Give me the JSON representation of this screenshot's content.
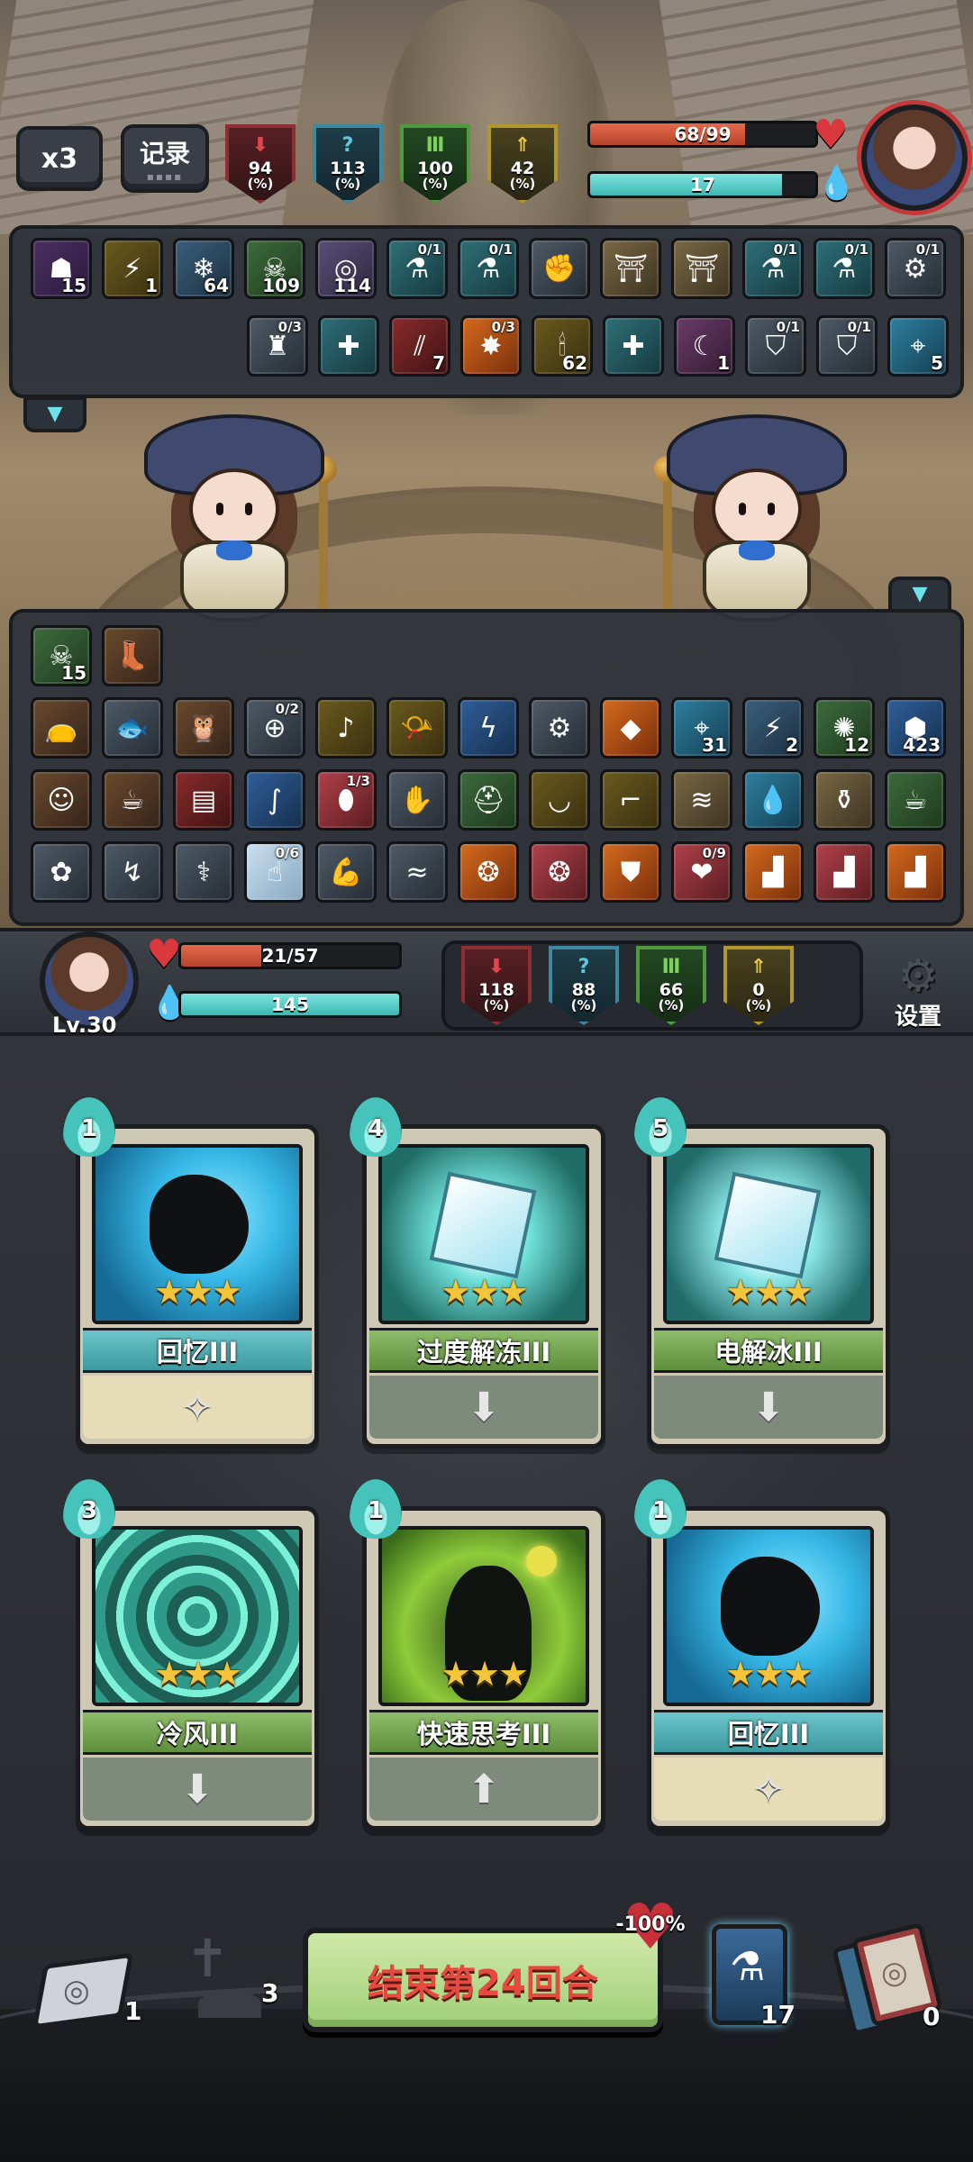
{
  "hud": {
    "speed_label": "x3",
    "log_label": "记录",
    "enemy_stats": [
      {
        "value": "94",
        "unit": "(%)",
        "color": "red",
        "icon": "attack-down-icon"
      },
      {
        "value": "113",
        "unit": "(%)",
        "color": "blue",
        "icon": "question-icon"
      },
      {
        "value": "100",
        "unit": "(%)",
        "color": "green",
        "icon": "defense-icon"
      },
      {
        "value": "42",
        "unit": "(%)",
        "color": "yellow",
        "icon": "speed-icon"
      }
    ],
    "enemy_hp_text": "68/99",
    "enemy_hp_fraction": 0.687,
    "enemy_mana_text": "17",
    "enemy_mana_fraction": 0.85
  },
  "enemy_status": {
    "row1": [
      {
        "icon": "curse-figure-icon",
        "count": "15",
        "color": "purple"
      },
      {
        "icon": "lightning-icon",
        "count": "1",
        "color": "gold"
      },
      {
        "icon": "snowflake-icon",
        "count": "64",
        "color": "ice"
      },
      {
        "icon": "poison-skull-icon",
        "count": "109",
        "color": "green"
      },
      {
        "icon": "spiral-icon",
        "count": "114",
        "color": "lilac"
      },
      {
        "icon": "potion-icon",
        "frac": "0/1",
        "color": "teal"
      },
      {
        "icon": "potion-icon",
        "frac": "0/1",
        "color": "teal"
      },
      {
        "icon": "fist-icon",
        "color": "slate"
      },
      {
        "icon": "pedestal-icon",
        "color": "sand"
      },
      {
        "icon": "pedestal-icon",
        "color": "sand"
      },
      {
        "icon": "potion-icon",
        "frac": "0/1",
        "color": "teal"
      },
      {
        "icon": "potion-icon",
        "frac": "0/1",
        "color": "teal"
      },
      {
        "icon": "robot-icon",
        "frac": "0/1",
        "color": "slate"
      }
    ],
    "row2": [
      {
        "icon": "statue-icon",
        "frac": "0/3",
        "color": "slate"
      },
      {
        "icon": "body-plus-icon",
        "color": "teal"
      },
      {
        "icon": "claw-icon",
        "count": "7",
        "color": "red"
      },
      {
        "icon": "burst-icon",
        "frac": "0/3",
        "color": "orange"
      },
      {
        "icon": "candle-icon",
        "count": "62",
        "color": "gold"
      },
      {
        "icon": "body-plus-icon",
        "color": "teal"
      },
      {
        "icon": "moon-icon",
        "count": "1",
        "color": "dpurple"
      },
      {
        "icon": "shield-icon",
        "frac": "0/1",
        "color": "slate"
      },
      {
        "icon": "shield-icon",
        "frac": "0/1",
        "color": "slate"
      },
      {
        "icon": "target-icon",
        "count": "5",
        "color": "cyan"
      }
    ]
  },
  "player_status": {
    "row1": [
      {
        "icon": "poison-skull-icon",
        "count": "15",
        "color": "green"
      },
      {
        "icon": "boots-icon",
        "color": "brown"
      }
    ],
    "row2": [
      {
        "icon": "pouch-icon",
        "color": "brown"
      },
      {
        "icon": "fish-icon",
        "color": "slate"
      },
      {
        "icon": "owl-icon",
        "color": "brown"
      },
      {
        "icon": "binoculars-icon",
        "frac": "0/2",
        "color": "slate"
      },
      {
        "icon": "flute-icon",
        "color": "gold"
      },
      {
        "icon": "horn-icon",
        "color": "gold"
      },
      {
        "icon": "lightning-swirl-icon",
        "color": "blue"
      },
      {
        "icon": "gear-disc-icon",
        "color": "slate"
      },
      {
        "icon": "crystal-icon",
        "color": "orange"
      },
      {
        "icon": "target-icon",
        "count": "31",
        "color": "cyan"
      },
      {
        "icon": "lightning-icon",
        "count": "2",
        "color": "ice"
      },
      {
        "icon": "leaf-burst-icon",
        "count": "12",
        "color": "green"
      },
      {
        "icon": "hexagon-shield-icon",
        "count": "423",
        "color": "blue"
      }
    ],
    "row3": [
      {
        "icon": "doll-icon",
        "color": "brown"
      },
      {
        "icon": "teapot-icon",
        "color": "brown"
      },
      {
        "icon": "book-icon",
        "color": "red"
      },
      {
        "icon": "scarf-icon",
        "color": "blue"
      },
      {
        "icon": "egg-icon",
        "frac": "1/3",
        "color": "rose"
      },
      {
        "icon": "hand-icon",
        "color": "slate"
      },
      {
        "icon": "helmet-icon",
        "color": "green"
      },
      {
        "icon": "bowl-icon",
        "color": "gold"
      },
      {
        "icon": "gun-icon",
        "color": "gold"
      },
      {
        "icon": "scroll-icon",
        "color": "sand"
      },
      {
        "icon": "water-drop-icon",
        "color": "cyan"
      },
      {
        "icon": "bottle-icon",
        "color": "sand"
      },
      {
        "icon": "cup-icon",
        "color": "green"
      }
    ],
    "row4": [
      {
        "icon": "brain-icon",
        "color": "slate"
      },
      {
        "icon": "lightning-arrow-icon",
        "color": "slate"
      },
      {
        "icon": "caduceus-icon",
        "color": "slate"
      },
      {
        "icon": "hand-gesture-icon",
        "frac": "0/6",
        "color": "pale"
      },
      {
        "icon": "muscle-icon",
        "color": "slate"
      },
      {
        "icon": "wave-icon",
        "color": "slate"
      },
      {
        "icon": "fire-swirl-icon",
        "color": "orange"
      },
      {
        "icon": "fire-swirl-icon",
        "color": "rose"
      },
      {
        "icon": "fire-shield-icon",
        "color": "orange"
      },
      {
        "icon": "fire-heart-icon",
        "frac": "0/9",
        "color": "rose"
      },
      {
        "icon": "fire-boot-icon",
        "color": "orange"
      },
      {
        "icon": "fire-boot-icon",
        "color": "rose"
      },
      {
        "icon": "fire-boot-icon",
        "color": "orange"
      }
    ]
  },
  "player": {
    "level": "Lv.30",
    "hp_text": "21/57",
    "hp_fraction": 0.368,
    "mana_text": "145",
    "mana_fraction": 1.0,
    "stats": [
      {
        "value": "118",
        "unit": "(%)",
        "color": "red",
        "icon": "attack-down-icon"
      },
      {
        "value": "88",
        "unit": "(%)",
        "color": "blue",
        "icon": "question-icon"
      },
      {
        "value": "66",
        "unit": "(%)",
        "color": "green",
        "icon": "defense-icon"
      },
      {
        "value": "0",
        "unit": "(%)",
        "color": "yellow",
        "icon": "speed-icon"
      }
    ],
    "settings_label": "设置"
  },
  "cards": [
    {
      "cost": "1",
      "name": "回忆III",
      "stars": "★★★",
      "band": "blue",
      "foot": "cream",
      "art": "recall",
      "foot_icon": "sparkle-icon"
    },
    {
      "cost": "4",
      "name": "过度解冻III",
      "stars": "★★★",
      "band": "green",
      "foot": "green",
      "art": "ice",
      "foot_icon": "arrow-down-icon"
    },
    {
      "cost": "5",
      "name": "电解冰III",
      "stars": "★★★",
      "band": "green",
      "foot": "green",
      "art": "ice2",
      "foot_icon": "arrow-down-icon"
    },
    {
      "cost": "3",
      "name": "冷风III",
      "stars": "★★★",
      "band": "green",
      "foot": "green",
      "art": "wind",
      "foot_icon": "arrow-down-icon"
    },
    {
      "cost": "1",
      "name": "快速思考III",
      "stars": "★★★",
      "band": "green",
      "foot": "green",
      "art": "think",
      "foot_icon": "arrow-up-icon"
    },
    {
      "cost": "1",
      "name": "回忆III",
      "stars": "★★★",
      "band": "blue",
      "foot": "cream",
      "art": "recall",
      "foot_icon": "sparkle-icon"
    }
  ],
  "bottom": {
    "draw_pile_count": "1",
    "grave_count": "3",
    "end_turn_label": "结束第24回合",
    "hp_cost_badge": "-100%",
    "potion_count": "17",
    "discard_pile_count": "0"
  }
}
